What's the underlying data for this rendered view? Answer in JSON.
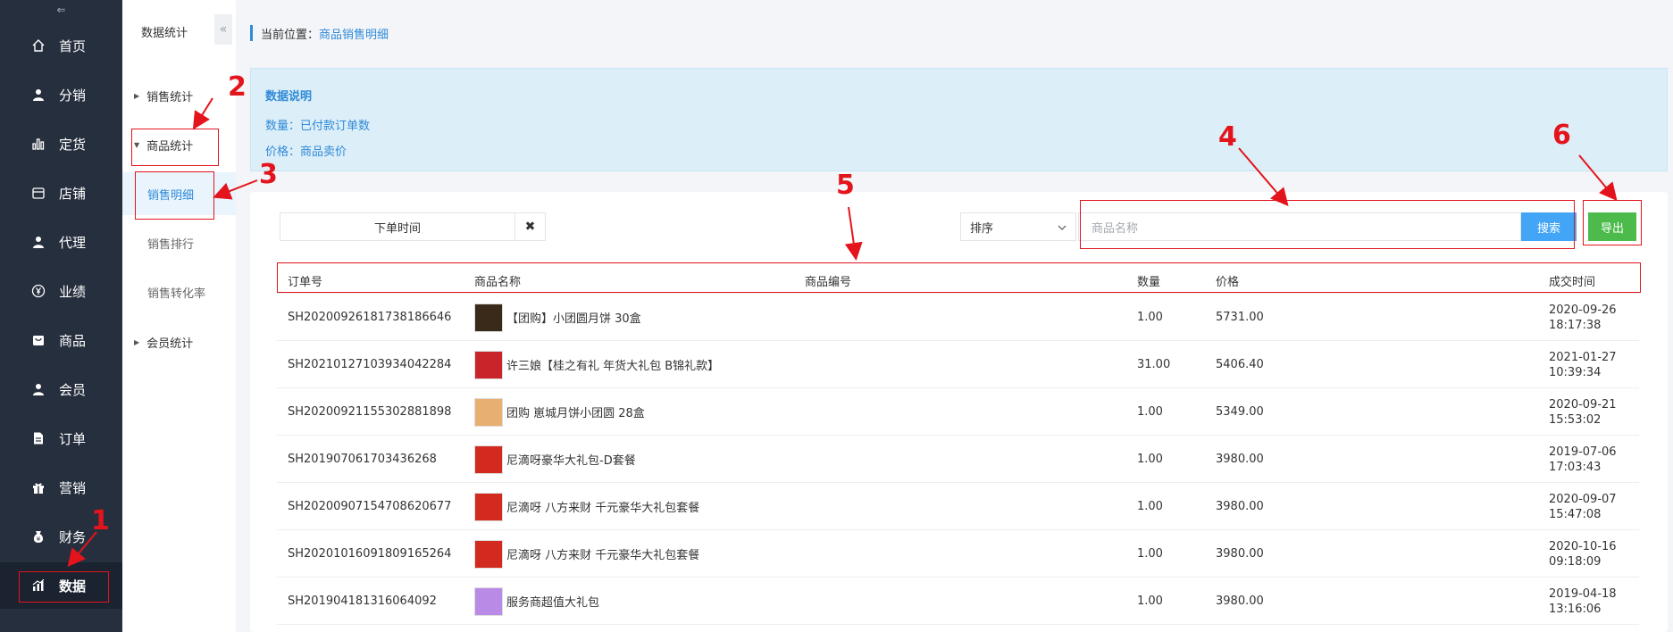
{
  "nav": {
    "collapse_glyph": "⇐",
    "items": [
      {
        "label": "首页",
        "icon": "home-icon"
      },
      {
        "label": "分销",
        "icon": "user-icon"
      },
      {
        "label": "定货",
        "icon": "bar-chart-icon"
      },
      {
        "label": "店铺",
        "icon": "store-icon"
      },
      {
        "label": "代理",
        "icon": "user-icon"
      },
      {
        "label": "业绩",
        "icon": "yen-icon"
      },
      {
        "label": "商品",
        "icon": "bag-icon"
      },
      {
        "label": "会员",
        "icon": "user-icon"
      },
      {
        "label": "订单",
        "icon": "document-icon"
      },
      {
        "label": "营销",
        "icon": "gift-icon"
      },
      {
        "label": "财务",
        "icon": "money-bag-icon"
      },
      {
        "label": "数据",
        "icon": "data-chart-icon"
      }
    ]
  },
  "subnav": {
    "title": "数据统计",
    "toggle_glyph": "«",
    "groups": [
      {
        "label": "销售统计"
      },
      {
        "label": "商品统计"
      },
      {
        "label": "会员统计"
      }
    ],
    "leaves": [
      {
        "label": "销售明细"
      },
      {
        "label": "销售排行"
      },
      {
        "label": "销售转化率"
      }
    ]
  },
  "breadcrumb": {
    "prefix": "当前位置：",
    "current": "商品销售明细"
  },
  "info": {
    "title": "数据说明",
    "line1": "数量：已付款订单数",
    "line2": "价格：商品卖价"
  },
  "filters": {
    "date_label": "下单时间",
    "clear_glyph": "✖",
    "sort_label": "排序",
    "search_placeholder": "商品名称",
    "search_button": "搜索",
    "export_button": "导出"
  },
  "table": {
    "headers": {
      "order_no": "订单号",
      "product_name": "商品名称",
      "product_code": "商品编号",
      "quantity": "数量",
      "price": "价格",
      "deal_time": "成交时间"
    },
    "rows": [
      {
        "order_no": "SH2020092618173818664​6",
        "name": "【团购】小团圆月饼 30盒",
        "qty": "1.00",
        "price": "5731.00",
        "date": "2020-09-26",
        "time": "18:17:38",
        "thumb": "#3a2a1a"
      },
      {
        "order_no": "SH20210127103934042284",
        "name": "许三娘【桂之有礼 年货大礼包 B锦礼款】",
        "qty": "31.00",
        "price": "5406.40",
        "date": "2021-01-27",
        "time": "10:39:34",
        "thumb": "#c8242a"
      },
      {
        "order_no": "SH20200921155302881898",
        "name": "团购 崽城月饼小团圆 28盒",
        "qty": "1.00",
        "price": "5349.00",
        "date": "2020-09-21",
        "time": "15:53:02",
        "thumb": "#e8b070"
      },
      {
        "order_no": "SH201907061703436268",
        "name": "尼滴呀豪华大礼包-D套餐",
        "qty": "1.00",
        "price": "3980.00",
        "date": "2019-07-06",
        "time": "17:03:43",
        "thumb": "#d32a1f"
      },
      {
        "order_no": "SH20200907154708620677",
        "name": "尼滴呀 八方来财 千元豪华大礼包套餐",
        "qty": "1.00",
        "price": "3980.00",
        "date": "2020-09-07",
        "time": "15:47:08",
        "thumb": "#d32a1f"
      },
      {
        "order_no": "SH20201016091809165264",
        "name": "尼滴呀 八方来财 千元豪华大礼包套餐",
        "qty": "1.00",
        "price": "3980.00",
        "date": "2020-10-16",
        "time": "09:18:09",
        "thumb": "#d32a1f"
      },
      {
        "order_no": "SH201904181316064092",
        "name": "服务商超值大礼包",
        "qty": "1.00",
        "price": "3980.00",
        "date": "2019-04-18",
        "time": "13:16:06",
        "thumb": "#b98be6"
      }
    ]
  },
  "annotations": [
    "1",
    "2",
    "3",
    "4",
    "5",
    "6"
  ],
  "colors": {
    "accent": "#2f8ad8",
    "annotation": "#e3141c",
    "search": "#42a5f5",
    "export": "#4cbb4c",
    "nav": "#262f3e"
  }
}
